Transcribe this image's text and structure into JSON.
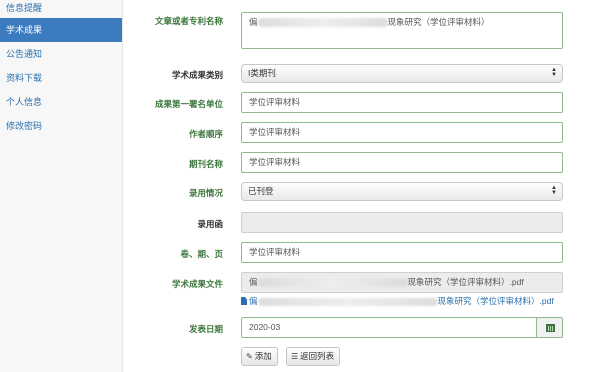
{
  "sidebar": {
    "items": [
      {
        "label": "信息提醒",
        "active": false
      },
      {
        "label": "学术成果",
        "active": true
      },
      {
        "label": "公告通知",
        "active": false
      },
      {
        "label": "资料下载",
        "active": false
      },
      {
        "label": "个人信息",
        "active": false
      },
      {
        "label": "修改密码",
        "active": false
      }
    ]
  },
  "form": {
    "title": {
      "label": "文章或者专利名称",
      "value_start": "偏",
      "value_end": "现象研究（学位评审材料）"
    },
    "category": {
      "label": "学术成果类别",
      "selected": "I类期刊"
    },
    "first_unit": {
      "label": "成果第一署名单位",
      "value": "学位评审材料"
    },
    "author_order": {
      "label": "作者顺序",
      "value": "学位评审材料"
    },
    "journal_name": {
      "label": "期刊名称",
      "value": "学位评审材料"
    },
    "status": {
      "label": "录用情况",
      "selected": "已刊登"
    },
    "acceptance_letter": {
      "label": "录用函",
      "value": ""
    },
    "volume_issue_page": {
      "label": "卷、期、页",
      "value": "学位评审材料"
    },
    "file": {
      "label": "学术成果文件",
      "value_start": "偏",
      "value_end": "现象研究（学位评审材料）.pdf",
      "link_start": "偏",
      "link_end": "现象研究（学位评审材料）.pdf"
    },
    "publish_date": {
      "label": "发表日期",
      "value": "2020-03"
    }
  },
  "actions": {
    "add_label": "添加",
    "back_label": "返回列表"
  },
  "colors": {
    "active_sidebar": "#3b7bbf",
    "green_label": "#3c763d",
    "link": "#2a6fad"
  }
}
